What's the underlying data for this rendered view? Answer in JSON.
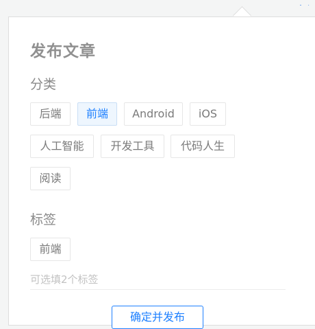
{
  "panel": {
    "title": "发布文章"
  },
  "category": {
    "label": "分类",
    "options": [
      "后端",
      "前端",
      "Android",
      "iOS",
      "人工智能",
      "开发工具",
      "代码人生",
      "阅读"
    ],
    "selected": "前端"
  },
  "tags": {
    "label": "标签",
    "selected": [
      "前端"
    ],
    "input_value": "",
    "input_placeholder": "可选填2个标签"
  },
  "publish": {
    "button_label": "确定并发布"
  },
  "colors": {
    "accent": "#1e80ff",
    "selected_bg": "#eef6fe"
  },
  "icons": {
    "corner": "send-icon"
  }
}
